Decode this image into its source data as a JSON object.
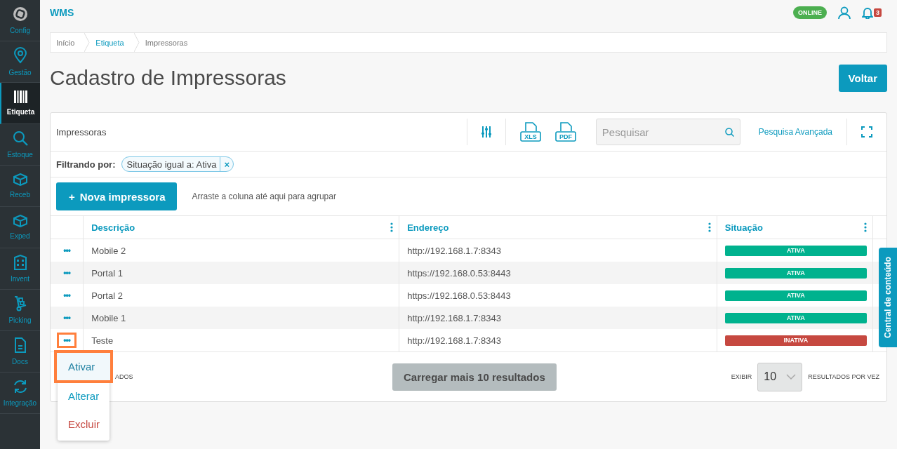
{
  "app": {
    "title": "WMS",
    "status": "ONLINE",
    "notifications": "3"
  },
  "sidebar": {
    "items": [
      {
        "kind": "config",
        "label": "Config",
        "selected": false
      },
      {
        "kind": "pin",
        "label": "Gestão",
        "selected": false
      },
      {
        "kind": "barcode",
        "label": "Etiqueta",
        "selected": true
      },
      {
        "kind": "search",
        "label": "Estoque",
        "selected": false
      },
      {
        "kind": "box",
        "label": "Receb",
        "selected": false
      },
      {
        "kind": "box",
        "label": "Exped",
        "selected": false
      },
      {
        "kind": "building",
        "label": "Invent",
        "selected": false
      },
      {
        "kind": "dolly",
        "label": "Picking",
        "selected": false
      },
      {
        "kind": "doc",
        "label": "Docs",
        "selected": false
      },
      {
        "kind": "sync",
        "label": "Integração",
        "selected": false
      }
    ]
  },
  "breadcrumb": [
    "Início",
    "Etiqueta",
    "Impressoras"
  ],
  "page": {
    "title": "Cadastro de Impressoras",
    "back_button": "Voltar"
  },
  "grid": {
    "title": "Impressoras",
    "export_labels": [
      "XLS",
      "PDF"
    ],
    "search": {
      "placeholder": "Pesquisar"
    },
    "advanced_search": "Pesquisa Avançada",
    "filter": {
      "label": "Filtrando por:",
      "chip": "Situação igual a: Ativa",
      "remove": "×"
    },
    "new_button": "Nova impressora",
    "new_icon": "+",
    "group_hint": "Arraste a coluna até aqui para agrupar",
    "columns": [
      "Descrição",
      "Endereço",
      "Situação"
    ],
    "rows": [
      {
        "actions": "•••",
        "highlighted": false,
        "description": "Mobile 2",
        "address": "http://192.168.1.7:8343",
        "status": "ATIVA",
        "color": "#00b28e"
      },
      {
        "actions": "•••",
        "highlighted": false,
        "description": "Portal 1",
        "address": "https://192.168.0.53:8443",
        "status": "ATIVA",
        "color": "#00b28e"
      },
      {
        "actions": "•••",
        "highlighted": false,
        "description": "Portal 2",
        "address": "https://192.168.0.53:8443",
        "status": "ATIVA",
        "color": "#00b28e"
      },
      {
        "actions": "•••",
        "highlighted": false,
        "description": "Mobile 1",
        "address": "http://192.168.1.7:8343",
        "status": "ATIVA",
        "color": "#00b28e"
      },
      {
        "actions": "•••",
        "highlighted": true,
        "description": "Teste",
        "address": "http://192.168.1.7:8343",
        "status": "INATIVA",
        "color": "#c64840"
      }
    ],
    "footer": {
      "count_text": "ADOS",
      "load_more": "Carregar mais 10 resultados",
      "show_label": "EXIBIR",
      "page_size": "10",
      "per_page_label": "RESULTADOS POR VEZ"
    },
    "menu": [
      {
        "label": "Ativar",
        "kind": "normal",
        "selected": true
      },
      {
        "label": "Alterar",
        "kind": "normal",
        "selected": false
      },
      {
        "label": "Excluir",
        "kind": "danger",
        "selected": false
      }
    ]
  },
  "side_tab": "Central de conteúdo"
}
